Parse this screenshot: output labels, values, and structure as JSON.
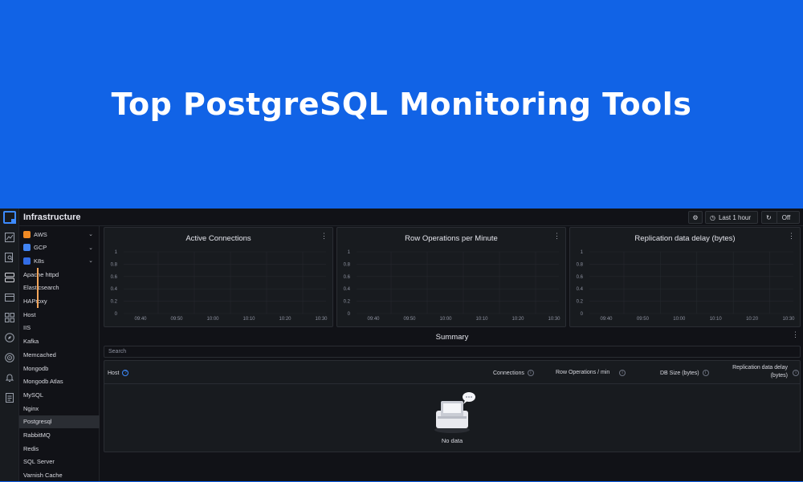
{
  "banner": {
    "headline": "Top PostgreSQL Monitoring Tools"
  },
  "topbar": {
    "title": "Infrastructure",
    "time_range": "Last 1 hour",
    "refresh": "Off"
  },
  "sidebar": {
    "items": [
      {
        "label": "AWS",
        "icon_color": "#f08a24",
        "expandable": true
      },
      {
        "label": "GCP",
        "icon_color": "#4285f4",
        "expandable": true
      },
      {
        "label": "K8s",
        "icon_color": "#326ce5",
        "expandable": true
      },
      {
        "label": "Apache httpd"
      },
      {
        "label": "Elasticsearch"
      },
      {
        "label": "HAProxy"
      },
      {
        "label": "Host"
      },
      {
        "label": "IIS"
      },
      {
        "label": "Kafka"
      },
      {
        "label": "Memcached"
      },
      {
        "label": "Mongodb"
      },
      {
        "label": "Mongodb Atlas"
      },
      {
        "label": "MySQL"
      },
      {
        "label": "Nginx"
      },
      {
        "label": "Postgresql",
        "active": true
      },
      {
        "label": "RabbitMQ"
      },
      {
        "label": "Redis"
      },
      {
        "label": "SQL Server"
      },
      {
        "label": "Varnish Cache"
      }
    ]
  },
  "panels": [
    {
      "title": "Active Connections"
    },
    {
      "title": "Row Operations per Minute"
    },
    {
      "title": "Replication data delay (bytes)"
    }
  ],
  "chart_data": [
    {
      "type": "line",
      "title": "Active Connections",
      "x": [
        "09:40",
        "09:50",
        "10:00",
        "10:10",
        "10:20",
        "10:30"
      ],
      "y_ticks": [
        0,
        0.2,
        0.4,
        0.6,
        0.8,
        1
      ],
      "ylim": [
        0,
        1
      ],
      "series": []
    },
    {
      "type": "line",
      "title": "Row Operations per Minute",
      "x": [
        "09:40",
        "09:50",
        "10:00",
        "10:10",
        "10:20",
        "10:30"
      ],
      "y_ticks": [
        0,
        0.2,
        0.4,
        0.6,
        0.8,
        1
      ],
      "ylim": [
        0,
        1
      ],
      "series": []
    },
    {
      "type": "line",
      "title": "Replication data delay (bytes)",
      "x": [
        "09:40",
        "09:50",
        "10:00",
        "10:10",
        "10:20",
        "10:30"
      ],
      "y_ticks": [
        0,
        0.2,
        0.4,
        0.6,
        0.8,
        1
      ],
      "ylim": [
        0,
        1
      ],
      "series": []
    }
  ],
  "summary": {
    "title": "Summary",
    "search_placeholder": "Search",
    "columns": {
      "host": "Host",
      "connections": "Connections",
      "row_ops": "Row Operations / min",
      "db_size": "DB Size (bytes)",
      "replication_1": "Replication data delay",
      "replication_2": "(bytes)"
    },
    "empty_text": "No data"
  },
  "colors": {
    "accent": "#3d8bff",
    "active_marker": "#f5a65b",
    "banner": "#1163e6"
  }
}
